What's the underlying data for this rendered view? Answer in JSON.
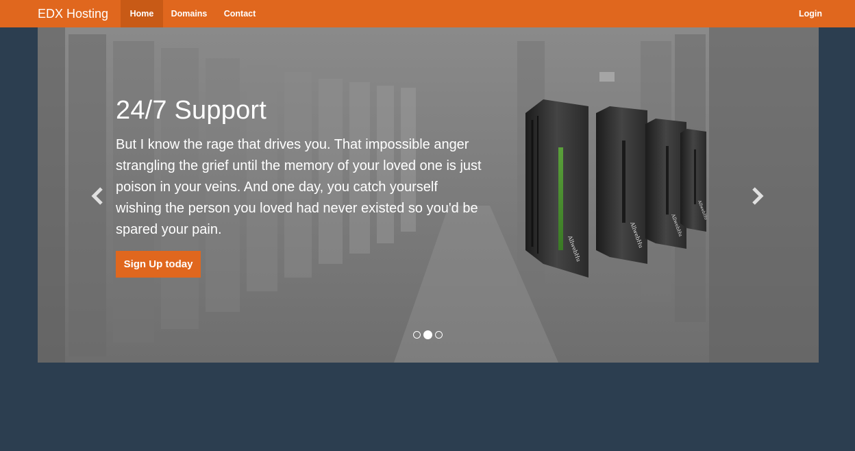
{
  "navbar": {
    "brand": "EDX Hosting",
    "links": [
      "Home",
      "Domains",
      "Contact"
    ],
    "active": "Home",
    "login": "Login"
  },
  "carousel": {
    "slide": {
      "title": "24/7 Support",
      "text": "But I know the rage that drives you. That impossible anger strangling the grief until the memory of your loved one is just poison in your veins. And one day, you catch yourself wishing the person you loved had never existed so you'd be spared your pain.",
      "button": "Sign Up today",
      "server_labels": [
        "AllwebHu",
        "AllwebHu",
        "AllwebHu",
        "AllwebHu"
      ]
    },
    "indicators": 3,
    "active_indicator": 2
  },
  "colors": {
    "accent": "#e0671e",
    "background": "#2c3e50"
  },
  "icons": [
    "chevron-left-icon",
    "chevron-right-icon"
  ]
}
